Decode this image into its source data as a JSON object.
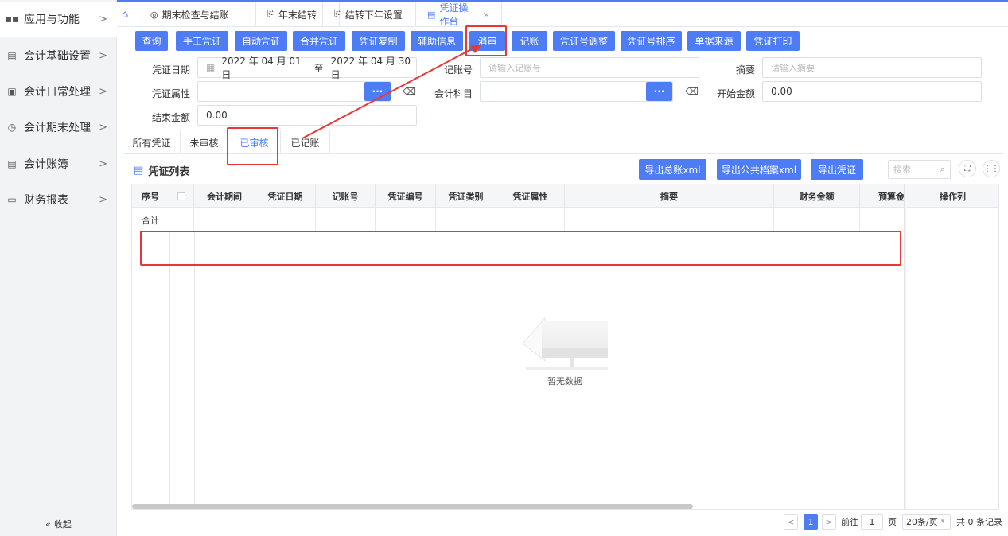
{
  "sidebar": {
    "items": [
      {
        "label": "应用与功能",
        "icon": "grid-icon"
      },
      {
        "label": "会计基础设置",
        "icon": "doc-icon"
      },
      {
        "label": "会计日常处理",
        "icon": "card-icon"
      },
      {
        "label": "会计期末处理",
        "icon": "clock-icon"
      },
      {
        "label": "会计账簿",
        "icon": "book-icon"
      },
      {
        "label": "财务报表",
        "icon": "report-icon"
      }
    ],
    "collapse_label": "收起"
  },
  "tabs": [
    {
      "label": "期末检查与结账"
    },
    {
      "label": "年末结转"
    },
    {
      "label": "结转下年设置"
    },
    {
      "label": "凭证操作台"
    }
  ],
  "toolbar": {
    "buttons": [
      "查询",
      "手工凭证",
      "自动凭证",
      "合并凭证",
      "凭证复制",
      "辅助信息",
      "消审",
      "记账",
      "凭证号调整",
      "凭证号排序",
      "单据来源",
      "凭证打印"
    ]
  },
  "form": {
    "date_label": "凭证日期",
    "date_from": "2022 年 04 月 01 日",
    "date_to_sep": "至",
    "date_to": "2022 年 04 月 30 日",
    "account_no_label": "记账号",
    "account_no_placeholder": "请输入记账号",
    "summary_label": "摘要",
    "summary_placeholder": "请输入摘要",
    "attr_label": "凭证属性",
    "subject_label": "会计科目",
    "start_amount_label": "开始金额",
    "start_amount_value": "0.00",
    "end_amount_label": "结束金额",
    "end_amount_value": "0.00",
    "dots": "···"
  },
  "filter_tabs": [
    "所有凭证",
    "未审核",
    "已审核",
    "已记账"
  ],
  "list": {
    "title": "凭证列表",
    "export_buttons": [
      "导出总账xml",
      "导出公共档案xml",
      "导出凭证"
    ],
    "search_placeholder": "搜索"
  },
  "table": {
    "columns": [
      "序号",
      "",
      "会计期间",
      "凭证日期",
      "记账号",
      "凭证编号",
      "凭证类别",
      "凭证属性",
      "摘要",
      "财务金额",
      "预算金",
      "操作列"
    ],
    "sum_label": "合计",
    "empty_text": "暂无数据"
  },
  "pagination": {
    "current_page": "1",
    "goto_label": "前往",
    "page_input": "1",
    "page_unit": "页",
    "page_size": "20条/页",
    "total_text": "共 0 条记录"
  },
  "colors": {
    "primary": "#4d7cf5",
    "annotation": "#e53935"
  }
}
